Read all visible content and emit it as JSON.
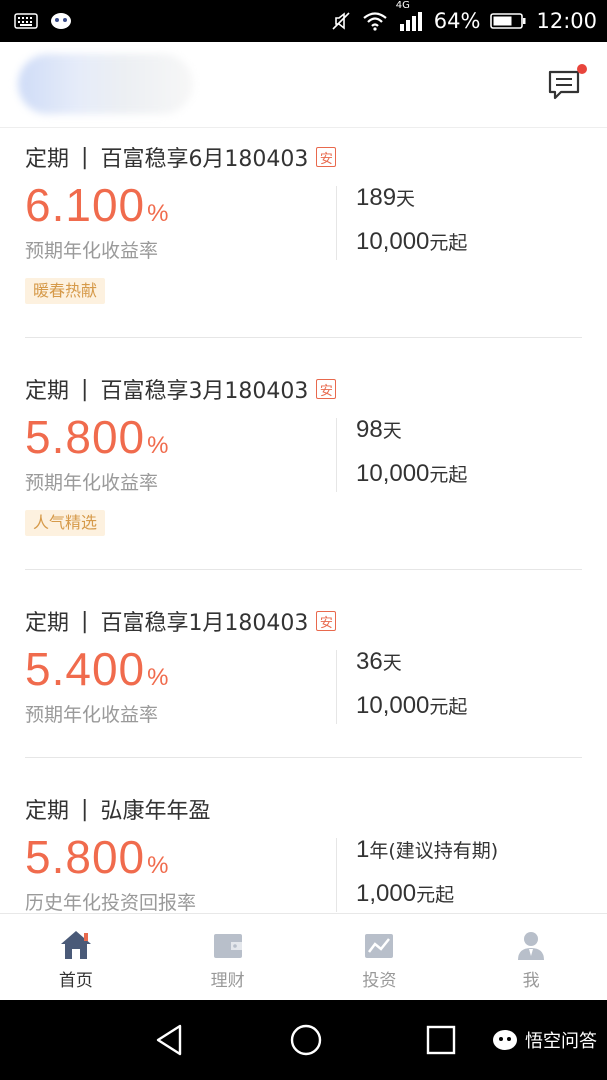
{
  "status_bar": {
    "network": "4G",
    "battery": "64%",
    "time": "12:00"
  },
  "header": {
    "message_icon": "message-icon"
  },
  "products": [
    {
      "type": "定期",
      "name": "百富稳享6月180403",
      "badge": "安",
      "rate": "6.100",
      "rate_unit": "%",
      "rate_label": "预期年化收益率",
      "term_value": "189",
      "term_unit": "天",
      "min_amount": "10,000",
      "min_unit": "元起",
      "tag": "暖春热献"
    },
    {
      "type": "定期",
      "name": "百富稳享3月180403",
      "badge": "安",
      "rate": "5.800",
      "rate_unit": "%",
      "rate_label": "预期年化收益率",
      "term_value": "98",
      "term_unit": "天",
      "min_amount": "10,000",
      "min_unit": "元起",
      "tag": "人气精选"
    },
    {
      "type": "定期",
      "name": "百富稳享1月180403",
      "badge": "安",
      "rate": "5.400",
      "rate_unit": "%",
      "rate_label": "预期年化收益率",
      "term_value": "36",
      "term_unit": "天",
      "min_amount": "10,000",
      "min_unit": "元起"
    },
    {
      "type": "定期",
      "name": "弘康年年盈",
      "rate": "5.800",
      "rate_unit": "%",
      "rate_label": "历史年化投资回报率",
      "term_value": "1",
      "term_unit": "年(建议持有期)",
      "min_amount": "1,000",
      "min_unit": "元起"
    }
  ],
  "tabs": [
    {
      "label": "首页",
      "icon": "home-icon",
      "active": true
    },
    {
      "label": "理财",
      "icon": "wallet-icon",
      "active": false
    },
    {
      "label": "投资",
      "icon": "chart-icon",
      "active": false
    },
    {
      "label": "我",
      "icon": "user-icon",
      "active": false
    }
  ],
  "watermark": "悟空问答",
  "colors": {
    "accent": "#f06b4d",
    "tag_bg": "#fdf1df",
    "tag_text": "#d69a4a",
    "tab_active": "#4a5a78",
    "tab_inactive": "#b8bfca"
  }
}
